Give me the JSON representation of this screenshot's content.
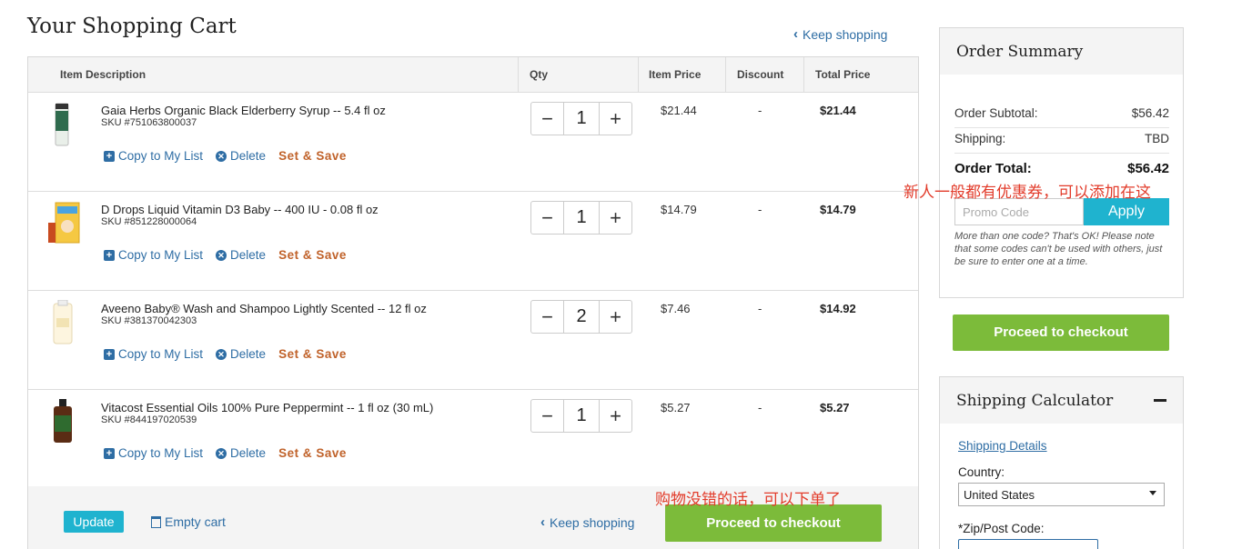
{
  "page_title": "Your Shopping Cart",
  "keep_shopping": "Keep shopping",
  "columns": {
    "item_description": "Item Description",
    "qty": "Qty",
    "item_price": "Item Price",
    "discount": "Discount",
    "total_price": "Total Price"
  },
  "item_actions": {
    "copy_to_list": "Copy to My List",
    "delete": "Delete",
    "set_and_save": "Set & Save"
  },
  "items": [
    {
      "name": "Gaia Herbs Organic Black Elderberry Syrup -- 5.4 fl oz",
      "sku": "SKU #751063800037",
      "qty": "1",
      "price": "$21.44",
      "discount": "-",
      "total": "$21.44"
    },
    {
      "name": "D Drops Liquid Vitamin D3 Baby -- 400 IU - 0.08 fl oz",
      "sku": "SKU #851228000064",
      "qty": "1",
      "price": "$14.79",
      "discount": "-",
      "total": "$14.79"
    },
    {
      "name": "Aveeno Baby® Wash and Shampoo Lightly Scented -- 12 fl oz",
      "sku": "SKU #381370042303",
      "qty": "2",
      "price": "$7.46",
      "discount": "-",
      "total": "$14.92"
    },
    {
      "name": "Vitacost Essential Oils 100% Pure Peppermint -- 1 fl oz (30 mL)",
      "sku": "SKU #844197020539",
      "qty": "1",
      "price": "$5.27",
      "discount": "-",
      "total": "$5.27"
    }
  ],
  "footer": {
    "update": "Update",
    "empty_cart": "Empty cart",
    "keep_shopping": "Keep shopping",
    "checkout": "Proceed to checkout"
  },
  "annotations": {
    "promo_note": "新人一般都有优惠券，可以添加在这",
    "checkout_note": "购物没错的话，可以下单了"
  },
  "summary": {
    "title": "Order Summary",
    "subtotal_label": "Order Subtotal:",
    "subtotal_value": "$56.42",
    "shipping_label": "Shipping:",
    "shipping_value": "TBD",
    "total_label": "Order Total:",
    "total_value": "$56.42",
    "promo_placeholder": "Promo Code",
    "apply": "Apply",
    "promo_help": "More than one code? That's OK! Please note that some codes can't be used with others, just be sure to enter one at a time.",
    "checkout": "Proceed to checkout"
  },
  "shipping_calculator": {
    "title": "Shipping Calculator",
    "details_link": "Shipping Details",
    "country_label": "Country:",
    "country_value": "United States",
    "zip_label": "*Zip/Post Code:"
  },
  "colors": {
    "link": "#2e6da4",
    "green_button": "#7cbb3a",
    "cyan_button": "#1fb3cf",
    "set_save": "#c0622a",
    "annotation": "#e23b2a"
  }
}
